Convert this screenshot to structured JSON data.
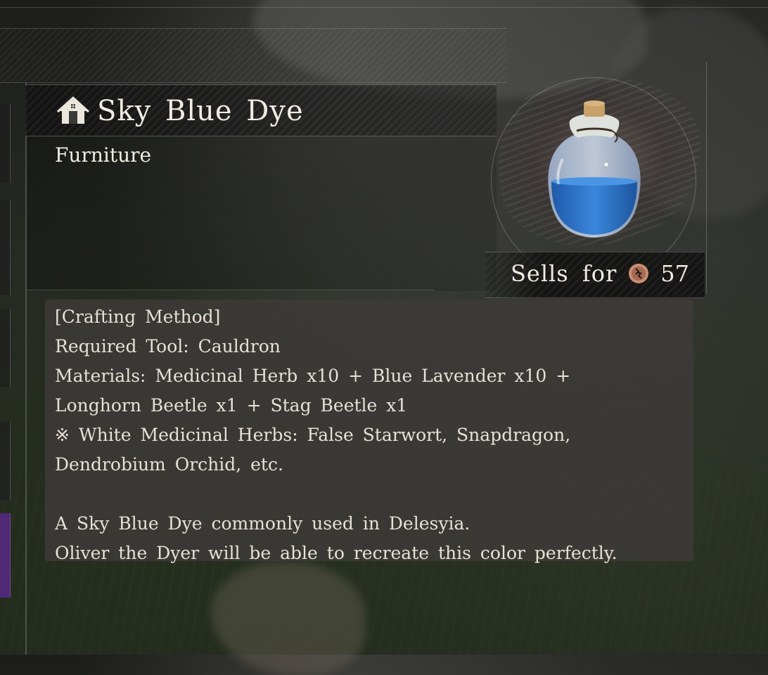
{
  "item": {
    "title": "Sky Blue Dye",
    "category": "Furniture",
    "category_icon": "house-icon",
    "sell_label": "Sells for",
    "sell_currency_icon": "coin-icon",
    "sell_value": "57"
  },
  "description": {
    "lines": [
      "[Crafting Method]",
      "Required Tool: Cauldron",
      "Materials: Medicinal Herb x10 + Blue Lavender x10 +",
      "Longhorn Beetle x1 + Stag Beetle x1",
      "※ White Medicinal Herbs: False Starwort, Snapdragon,",
      "Dendrobium Orchid, etc.",
      "",
      "A Sky Blue Dye commonly used in Delesyia.",
      "Oliver the Dyer will be able to recreate this color perfectly."
    ]
  },
  "colors": {
    "text": "#f1ece2",
    "panel": "#3e3a38",
    "liquid": "#2a6fc4",
    "coin": "#c98e74"
  }
}
